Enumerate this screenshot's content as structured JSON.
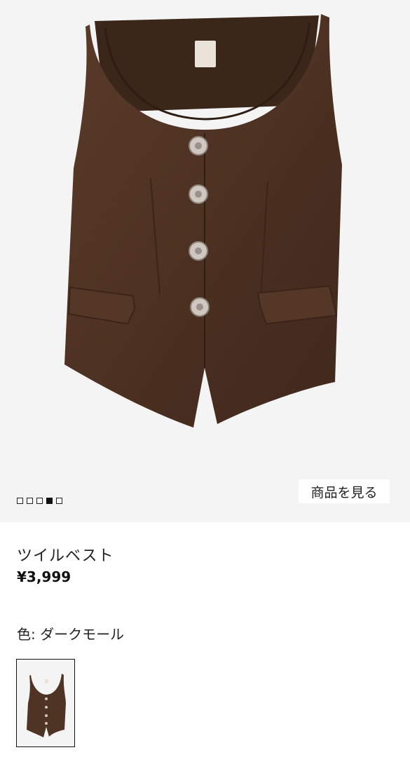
{
  "gallery": {
    "image_alt": "ツイルベスト",
    "dots": [
      {
        "active": false
      },
      {
        "active": false
      },
      {
        "active": false
      },
      {
        "active": true
      },
      {
        "active": false
      }
    ],
    "view_button_label": "商品を見る"
  },
  "product": {
    "name": "ツイルベスト",
    "price": "¥3,999",
    "color_label": "色:",
    "color_value": "ダークモール"
  },
  "colors": {
    "background": "#f4f4f4",
    "vest": "#4f3324",
    "text": "#222222"
  }
}
